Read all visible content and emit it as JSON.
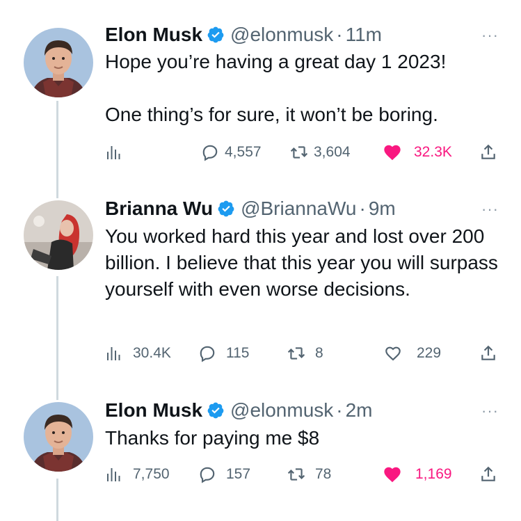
{
  "colors": {
    "verified_blue": "#1d9bf0",
    "like_pink": "#f91880",
    "secondary_text": "#536471",
    "thread_line": "#cfd9de"
  },
  "tweets": [
    {
      "name": "Elon Musk",
      "handle": "@elonmusk",
      "separator": "·",
      "time": "11m",
      "avatar_icon": "elon-musk-avatar",
      "text_lines": [
        "Hope you’re having a great day 1 2023!",
        "One thing’s for sure, it won’t be boring."
      ],
      "views": "",
      "replies": "4,557",
      "retweets": "3,604",
      "likes": "32.3K",
      "liked": true
    },
    {
      "name": "Brianna Wu",
      "handle": "@BriannaWu",
      "separator": "·",
      "time": "9m",
      "avatar_icon": "brianna-wu-avatar",
      "text_lines": [
        "You worked hard this year and lost over 200 billion. I believe that this year you will surpass yourself with even worse decisions."
      ],
      "views": "30.4K",
      "replies": "115",
      "retweets": "8",
      "likes": "229",
      "liked": false
    },
    {
      "name": "Elon Musk",
      "handle": "@elonmusk",
      "separator": "·",
      "time": "2m",
      "avatar_icon": "elon-musk-avatar",
      "text_lines": [
        "Thanks for paying me $8"
      ],
      "views": "7,750",
      "replies": "157",
      "retweets": "78",
      "likes": "1,169",
      "liked": true
    }
  ],
  "more_glyph": "···"
}
